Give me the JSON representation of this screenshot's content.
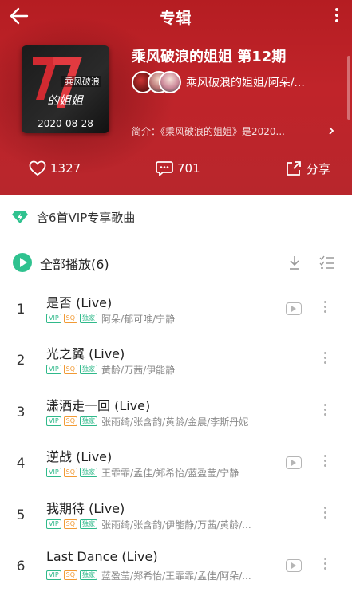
{
  "header": {
    "title": "专辑",
    "album_title": "乘风破浪的姐姐 第12期",
    "artist": "乘风破浪的姐姐/阿朵/...",
    "intro": "简介：《乘风破浪的姐姐》是2020...",
    "cover": {
      "date": "2020-08-28",
      "logo_text": "乘风破浪的姐姐"
    },
    "stats": {
      "likes": "1327",
      "comments": "701",
      "share": "分享"
    }
  },
  "vip_notice": "含6首VIP专享歌曲",
  "play_all": "全部播放(6)",
  "tags": {
    "vip": "VIP",
    "sq": "SQ",
    "exclusive": "独家"
  },
  "songs": [
    {
      "index": "1",
      "title": "是否 (Live)",
      "artists": "阿朵/郁可唯/宁静",
      "mv": true
    },
    {
      "index": "2",
      "title": "光之翼 (Live)",
      "artists": "黄龄/万茜/伊能静",
      "mv": false
    },
    {
      "index": "3",
      "title": "潇洒走一回 (Live)",
      "artists": "张雨绮/张含韵/黄龄/金晨/李斯丹妮",
      "mv": false
    },
    {
      "index": "4",
      "title": "逆战 (Live)",
      "artists": "王霏霏/孟佳/郑希怡/蓝盈莹/宁静",
      "mv": true
    },
    {
      "index": "5",
      "title": "我期待 (Live)",
      "artists": "张雨绮/张含韵/伊能静/万茜/黄龄/...",
      "mv": false
    },
    {
      "index": "6",
      "title": "Last Dance (Live)",
      "artists": "蓝盈莹/郑希怡/王霏霏/孟佳/阿朵/...",
      "mv": true
    }
  ],
  "colors": {
    "header_red": "#c0242a",
    "accent_green": "#2fc28f",
    "sq_orange": "#f19a34"
  }
}
